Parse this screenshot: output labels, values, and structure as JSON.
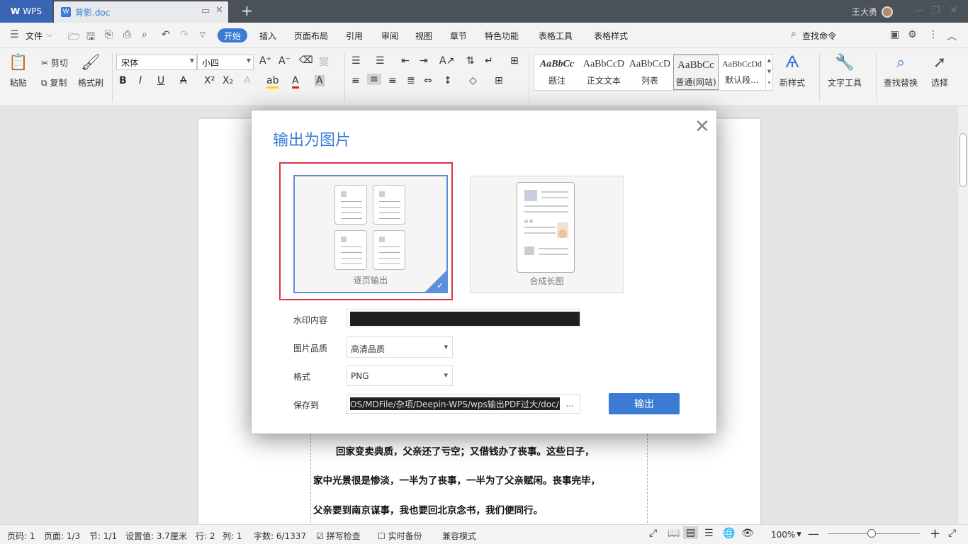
{
  "titlebar": {
    "app_tab": "WPS",
    "doc_tab": "背影.doc",
    "user_name": "王大勇"
  },
  "menu": {
    "file": "文件",
    "start": "开始",
    "items": [
      "插入",
      "页面布局",
      "引用",
      "审阅",
      "视图",
      "章节",
      "特色功能",
      "表格工具",
      "表格样式"
    ],
    "search": "查找命令"
  },
  "ribbon": {
    "paste": "粘贴",
    "cut": "剪切",
    "copy": "复制",
    "format_painter": "格式刷",
    "font_name": "宋体",
    "font_size": "小四",
    "styles": [
      {
        "preview": "AaBbCc",
        "label": "题注"
      },
      {
        "preview": "AaBbCcD",
        "label": "正文文本"
      },
      {
        "preview": "AaBbCcD",
        "label": "列表"
      },
      {
        "preview": "AaBbCc",
        "label": "普通(网站)"
      },
      {
        "preview": "AaBbCcDd",
        "label": "默认段..."
      }
    ],
    "new_style": "新样式",
    "text_tools": "文字工具",
    "find_replace": "查找替换",
    "select": "选择"
  },
  "document": {
    "paragraphs": [
      "回家变卖典质，父亲还了亏空；又借钱办了丧事。这些日子，",
      "家中光景很是惨淡，一半为了丧事，一半为了父亲赋闲。丧事完毕，",
      "父亲要到南京谋事，我也要回北京念书，我们便同行。"
    ]
  },
  "dialog": {
    "title": "输出为图片",
    "option_per_page": "逐页输出",
    "option_long_image": "合成长图",
    "watermark_label": "水印内容",
    "quality_label": "图片品质",
    "quality_value": "高清品质",
    "format_label": "格式",
    "format_value": "PNG",
    "save_label": "保存到",
    "save_path": "OS/MDFile/杂项/Deepin-WPS/wps输出PDF过大/doc/",
    "browse": "...",
    "export_button": "输出"
  },
  "status": {
    "page_num": "页码: 1",
    "pages": "页面: 1/3",
    "section": "节: 1/1",
    "setting": "设置值: 3.7厘米",
    "row": "行: 2",
    "col": "列: 1",
    "words": "字数: 6/1337",
    "spellcheck": "拼写检查",
    "backup": "实时备份",
    "compat": "兼容模式",
    "zoom": "100%"
  }
}
